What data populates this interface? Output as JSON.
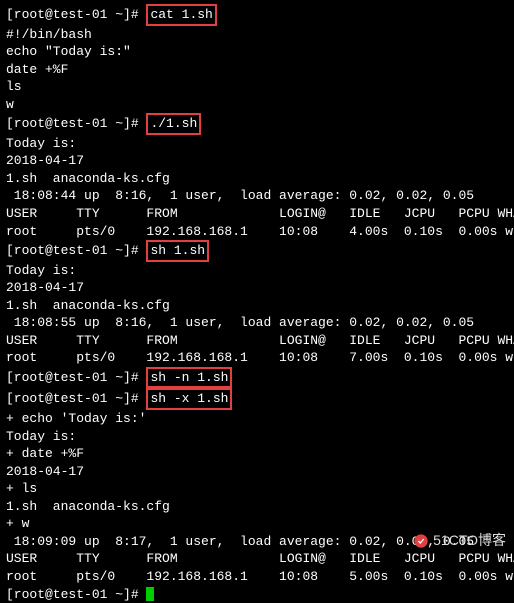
{
  "prompt": "[root@test-01 ~]# ",
  "cmd": {
    "cat": "cat 1.sh",
    "run": "./1.sh",
    "sh": "sh 1.sh",
    "shn": "sh -n 1.sh",
    "shx": "sh -x 1.sh"
  },
  "script": {
    "shebang": "#!/bin/bash",
    "echo": "echo \"Today is:\"",
    "date": "date +%F",
    "ls": "ls",
    "w": "w"
  },
  "out": {
    "today": "Today is:",
    "dateval": "2018-04-17",
    "lsfiles": "1.sh  anaconda-ks.cfg",
    "header": "USER     TTY      FROM             LOGIN@   IDLE   JCPU   PCPU WHAT",
    "up1": " 18:08:44 up  8:16,  1 user,  load average: 0.02, 0.02, 0.05",
    "row1": "root     pts/0    192.168.168.1    10:08    4.00s  0.10s  0.00s w",
    "up2": " 18:08:55 up  8:16,  1 user,  load average: 0.02, 0.02, 0.05",
    "row2": "root     pts/0    192.168.168.1    10:08    7.00s  0.10s  0.00s w",
    "up3": " 18:09:09 up  8:17,  1 user,  load average: 0.02, 0.02, 0.05",
    "row3": "root     pts/0    192.168.168.1    10:08    5.00s  0.10s  0.00s w"
  },
  "trace": {
    "echo": "+ echo 'Today is:'",
    "date": "+ date +%F",
    "ls": "+ ls",
    "w": "+ w"
  },
  "watermark": "51CTO博客"
}
